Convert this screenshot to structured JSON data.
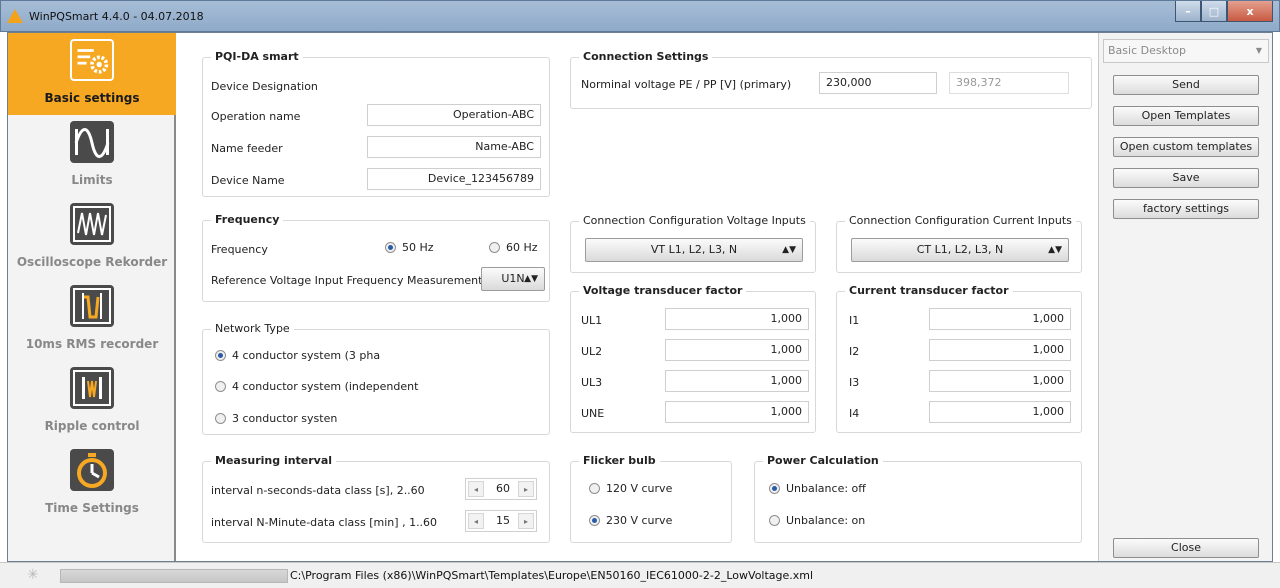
{
  "window": {
    "title": "WinPQSmart  4.4.0 - 04.07.2018",
    "minimize": "–",
    "maximize": "□",
    "close": "x"
  },
  "sidebar": {
    "items": [
      {
        "label": "Basic settings",
        "icon": "gear-settings-icon",
        "active": true
      },
      {
        "label": "Limits",
        "icon": "sine-wave-icon",
        "active": false
      },
      {
        "label": "Oscilloscope Rekorder",
        "icon": "oscilloscope-icon",
        "active": false
      },
      {
        "label": "10ms RMS recorder",
        "icon": "rms-recorder-icon",
        "active": false
      },
      {
        "label": "Ripple control",
        "icon": "ripple-control-icon",
        "active": false
      },
      {
        "label": "Time Settings",
        "icon": "stopwatch-icon",
        "active": false
      }
    ]
  },
  "pqi": {
    "title": "PQI-DA smart",
    "device_designation": "Device Designation",
    "operation_name_label": "Operation name",
    "operation_name_value": "Operation-ABC",
    "name_feeder_label": "Name feeder",
    "name_feeder_value": "Name-ABC",
    "device_name_label": "Device Name",
    "device_name_value": "Device_123456789"
  },
  "connection": {
    "title": "Connection Settings",
    "nominal_label": "Norminal voltage PE / PP [V] (primary)",
    "nominal_pe": "230,000",
    "nominal_pp": "398,372"
  },
  "frequency": {
    "title": "Frequency",
    "label": "Frequency",
    "opt_50": "50 Hz",
    "opt_60": "60 Hz",
    "selected": "50 Hz",
    "ref_label": "Reference Voltage Input Frequency Measurement",
    "ref_value": "U1N"
  },
  "network": {
    "title": "Network Type",
    "options": [
      "4 conductor system (3 pha",
      "4 conductor system (independent",
      "3 conductor systen"
    ],
    "selected_index": 0
  },
  "measuring": {
    "title": "Measuring interval",
    "n_seconds_label": "interval n-seconds-data class [s], 2..60",
    "n_seconds_value": "60",
    "n_minute_label": "interval  N-Minute-data class [min] , 1..60",
    "n_minute_value": "15"
  },
  "conn_voltage": {
    "title": "Connection Configuration Voltage Inputs",
    "value": "VT L1, L2, L3, N"
  },
  "conn_current": {
    "title": "Connection Configuration Current Inputs",
    "value": "CT L1, L2, L3, N"
  },
  "voltage_transducer": {
    "title": "Voltage transducer factor",
    "rows": [
      {
        "label": "UL1",
        "value": "1,000"
      },
      {
        "label": "UL2",
        "value": "1,000"
      },
      {
        "label": "UL3",
        "value": "1,000"
      },
      {
        "label": "UNE",
        "value": "1,000"
      }
    ]
  },
  "current_transducer": {
    "title": "Current transducer factor",
    "rows": [
      {
        "label": "I1",
        "value": "1,000"
      },
      {
        "label": "I2",
        "value": "1,000"
      },
      {
        "label": "I3",
        "value": "1,000"
      },
      {
        "label": "I4",
        "value": "1,000"
      }
    ]
  },
  "flicker": {
    "title": "Flicker bulb",
    "opt_120": "120 V curve",
    "opt_230": "230 V curve",
    "selected": "230 V curve"
  },
  "power": {
    "title": "Power Calculation",
    "opt_off": "Unbalance: off",
    "opt_on": "Unbalance: on",
    "selected": "Unbalance: off"
  },
  "right_panel": {
    "preset": "Basic Desktop",
    "send": "Send",
    "open_templates": "Open Templates",
    "open_custom": "Open custom templates",
    "save": "Save",
    "factory": "factory settings",
    "close": "Close"
  },
  "status": {
    "progress": 1.0,
    "path": "C:\\Program Files (x86)\\WinPQSmart\\Templates\\Europe\\EN50160_IEC61000-2-2_LowVoltage.xml"
  },
  "colors": {
    "accent": "#f7a823",
    "radio_dot": "#2a5aa8"
  }
}
